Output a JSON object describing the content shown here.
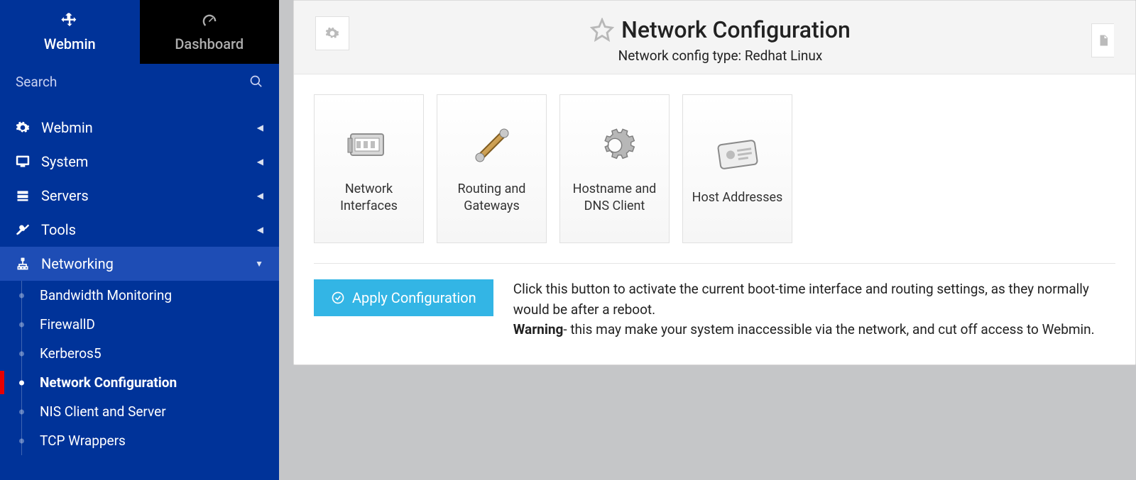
{
  "tabs": {
    "webmin": "Webmin",
    "dashboard": "Dashboard"
  },
  "search": {
    "placeholder": "Search"
  },
  "nav": {
    "webmin": "Webmin",
    "system": "System",
    "servers": "Servers",
    "tools": "Tools",
    "networking": "Networking"
  },
  "subnav": {
    "bandwidth": "Bandwidth Monitoring",
    "firewalld": "FirewallD",
    "kerberos5": "Kerberos5",
    "netconfig": "Network Configuration",
    "nis": "NIS Client and Server",
    "tcpwrappers": "TCP Wrappers"
  },
  "page": {
    "title": "Network Configuration",
    "subtitle": "Network config type: Redhat Linux"
  },
  "cards": {
    "interfaces": "Network Interfaces",
    "routing": "Routing and Gateways",
    "hostname": "Hostname and DNS Client",
    "hosts": "Host Addresses"
  },
  "apply": {
    "button": "Apply Configuration",
    "desc": "Click this button to activate the current boot-time interface and routing settings, as they normally would be after a reboot.",
    "warn_label": "Warning",
    "warn_text": "- this may make your system inaccessible via the network, and cut off access to Webmin."
  }
}
